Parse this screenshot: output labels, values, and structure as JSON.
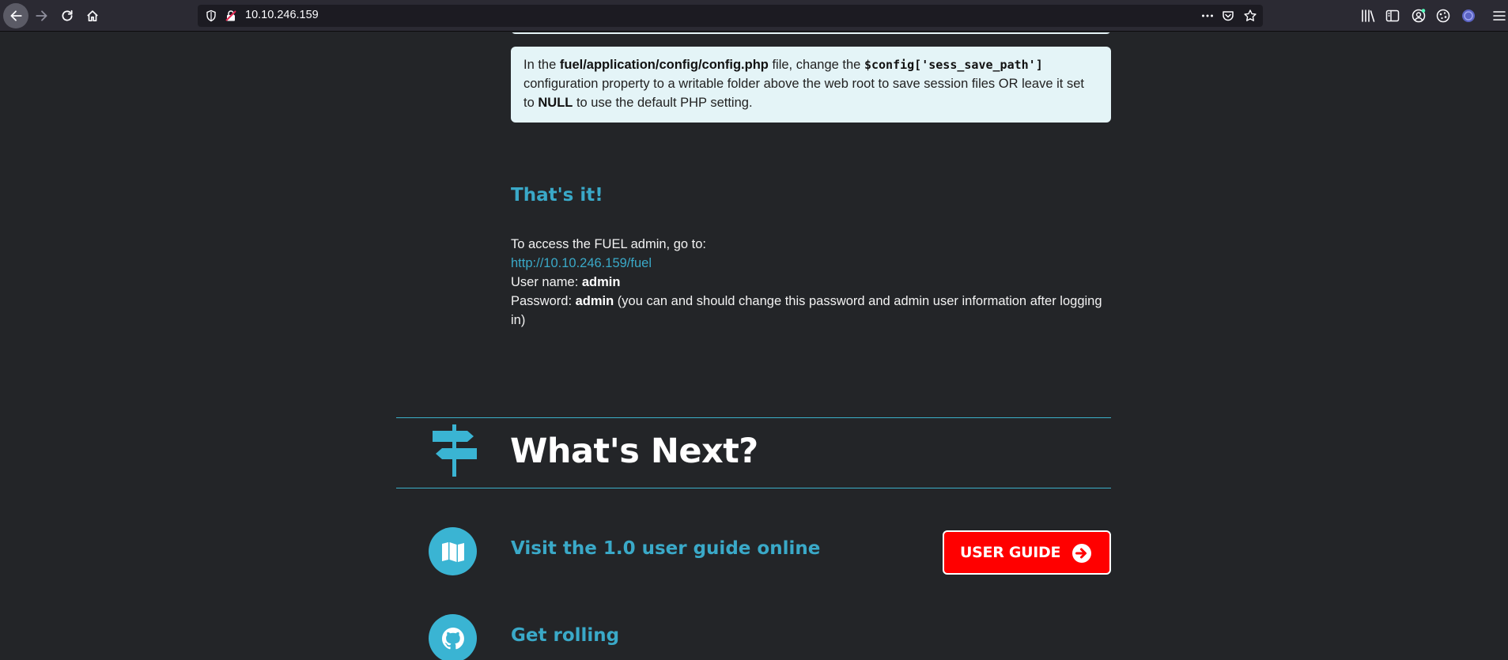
{
  "browser": {
    "url": "10.10.246.159",
    "icons": {
      "back": "back-arrow-icon",
      "forward": "forward-arrow-icon",
      "reload": "reload-icon",
      "home": "home-icon",
      "tracking": "shield-icon",
      "insecure": "insecure-lock-icon",
      "page_actions": "more-icon",
      "pocket": "pocket-icon",
      "bookmark": "star-icon",
      "library": "library-icon",
      "sidebar": "sidebar-icon",
      "account": "account-icon",
      "extension": "extension-icon",
      "vpn": "vpn-icon",
      "menu": "hamburger-menu-icon"
    }
  },
  "config_note": {
    "prefix": "In the ",
    "file": "fuel/application/config/config.php",
    "middle": " file, change the ",
    "code": "$config['sess_save_path']",
    "suffix": " configuration property to a writable folder above the web root to save session files OR leave it set to ",
    "null_word": "NULL",
    "end": " to use the default PHP setting."
  },
  "thats_it": {
    "title": "That's it!",
    "access_line": "To access the FUEL admin, go to:",
    "admin_url": "http://10.10.246.159/fuel",
    "username_label": "User name: ",
    "username": "admin",
    "password_label": "Password: ",
    "password": "admin",
    "password_note": " (you can and should change this password and admin user information after logging in)"
  },
  "whats_next": {
    "title": "What's Next?",
    "icon": "signpost-icon",
    "items": [
      {
        "label": "Visit the 1.0 user guide online",
        "icon": "map-icon",
        "button": "USER GUIDE",
        "button_icon": "arrow-circle-right-icon"
      },
      {
        "label": "Get rolling",
        "icon": "github-icon"
      }
    ]
  },
  "colors": {
    "page_background": "#232528",
    "accent": "#3aa9c8",
    "button_red": "#ff0000",
    "info_box": "#e4f4f7"
  }
}
